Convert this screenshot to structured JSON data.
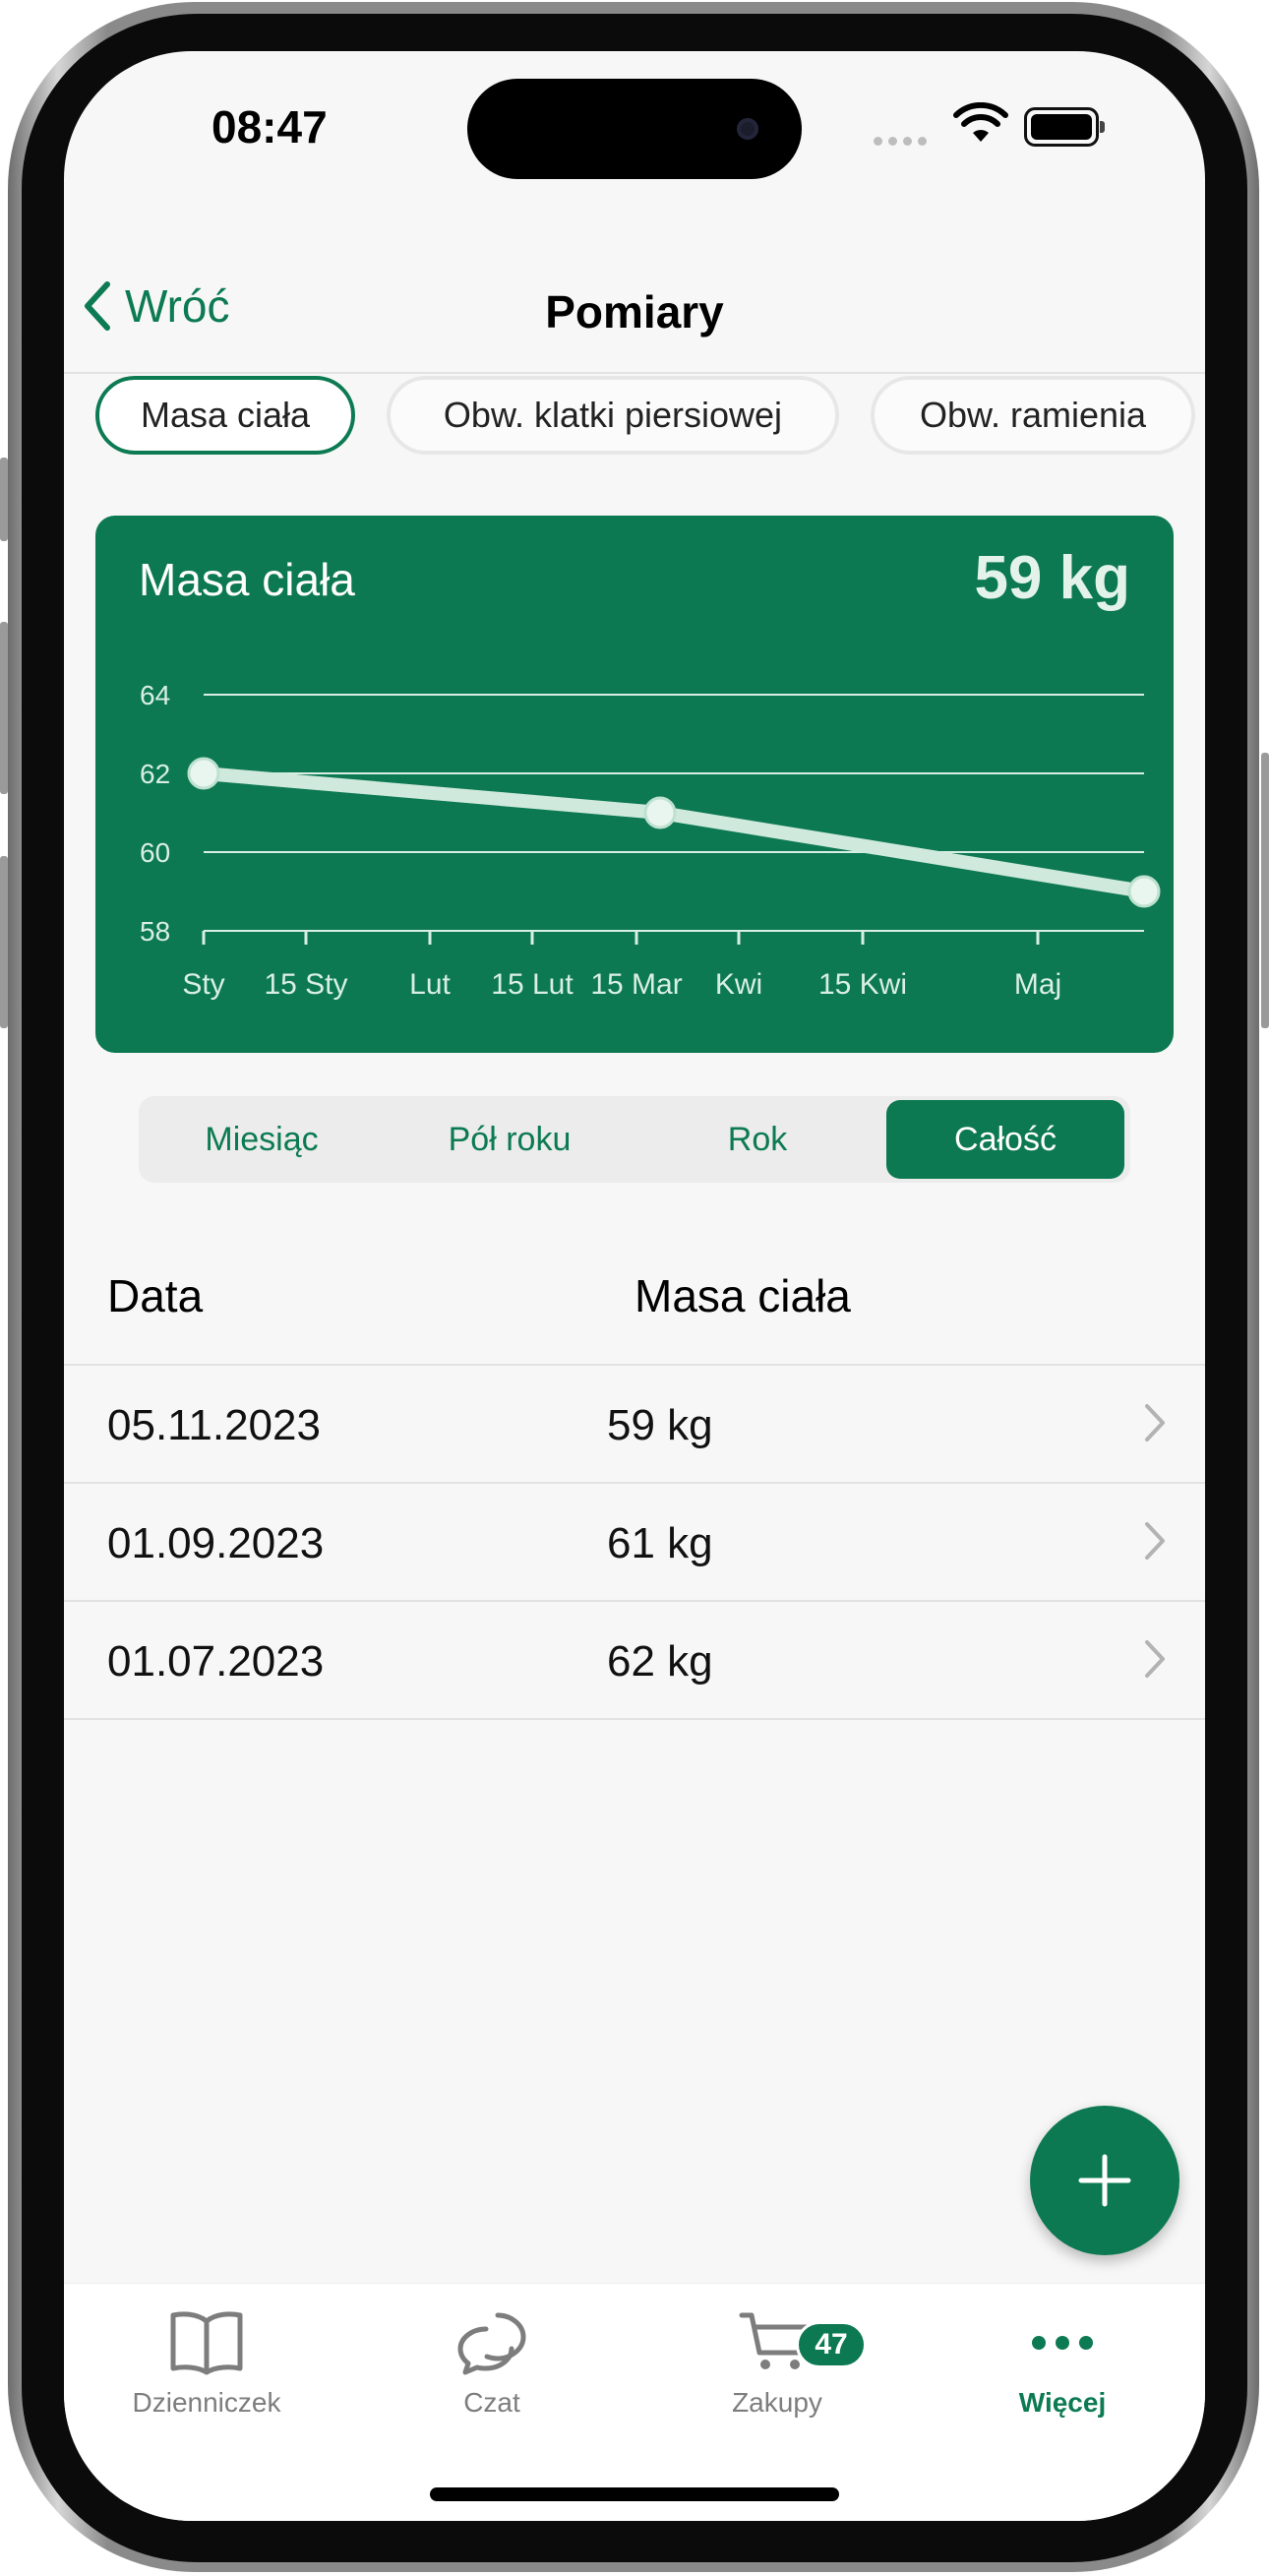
{
  "status": {
    "time": "08:47"
  },
  "nav": {
    "back_label": "Wróć",
    "title": "Pomiary"
  },
  "chips": [
    "Masa ciała",
    "Obw. klatki piersiowej",
    "Obw. ramienia"
  ],
  "card": {
    "title": "Masa ciała",
    "current_value": "59 kg"
  },
  "chart_data": {
    "type": "line",
    "title": "Masa ciała",
    "x_ticks": [
      "Sty",
      "15 Sty",
      "Lut",
      "15 Lut",
      "15 Mar",
      "Kwi",
      "15 Kwi",
      "Maj"
    ],
    "y_ticks": [
      58,
      60,
      62,
      64
    ],
    "ylim": [
      58,
      64
    ],
    "grid": true,
    "series": [
      {
        "x": [
          "Sty",
          "~1 Mar",
          "Maj"
        ],
        "values": [
          62,
          61,
          59
        ]
      }
    ],
    "colors": {
      "background": "#0c7952",
      "line": "#cfe9dc"
    }
  },
  "periods": [
    "Miesiąc",
    "Pół roku",
    "Rok",
    "Całość"
  ],
  "active_period": "Całość",
  "table": {
    "headers": [
      "Data",
      "Masa ciała"
    ],
    "rows": [
      {
        "date": "05.11.2023",
        "value": "59 kg"
      },
      {
        "date": "01.09.2023",
        "value": "61 kg"
      },
      {
        "date": "01.07.2023",
        "value": "62 kg"
      }
    ]
  },
  "tabs": [
    {
      "label": "Dzienniczek",
      "icon": "book-icon"
    },
    {
      "label": "Czat",
      "icon": "chat-icon"
    },
    {
      "label": "Zakupy",
      "icon": "cart-icon",
      "badge": "47"
    },
    {
      "label": "Więcej",
      "icon": "more-icon",
      "active": true
    }
  ],
  "colors": {
    "accent": "#0c7952"
  }
}
